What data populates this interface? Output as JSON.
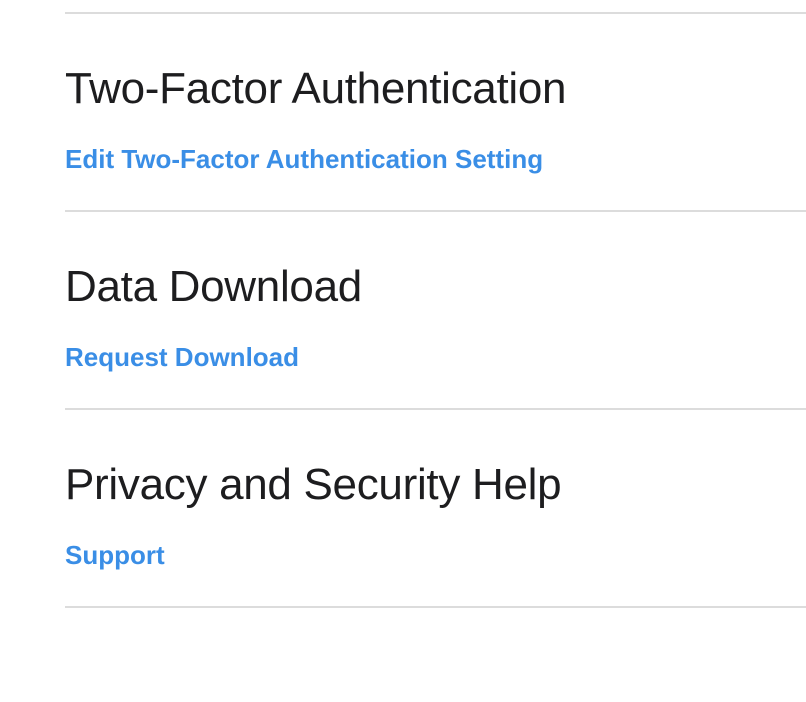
{
  "sections": [
    {
      "title": "Two-Factor Authentication",
      "link": "Edit Two-Factor Authentication Setting"
    },
    {
      "title": "Data Download",
      "link": "Request Download"
    },
    {
      "title": "Privacy and Security Help",
      "link": "Support"
    }
  ],
  "colors": {
    "link": "#3a8ee6",
    "heading": "#1d1d1f",
    "divider": "#dcdcdc",
    "background": "#ffffff"
  }
}
